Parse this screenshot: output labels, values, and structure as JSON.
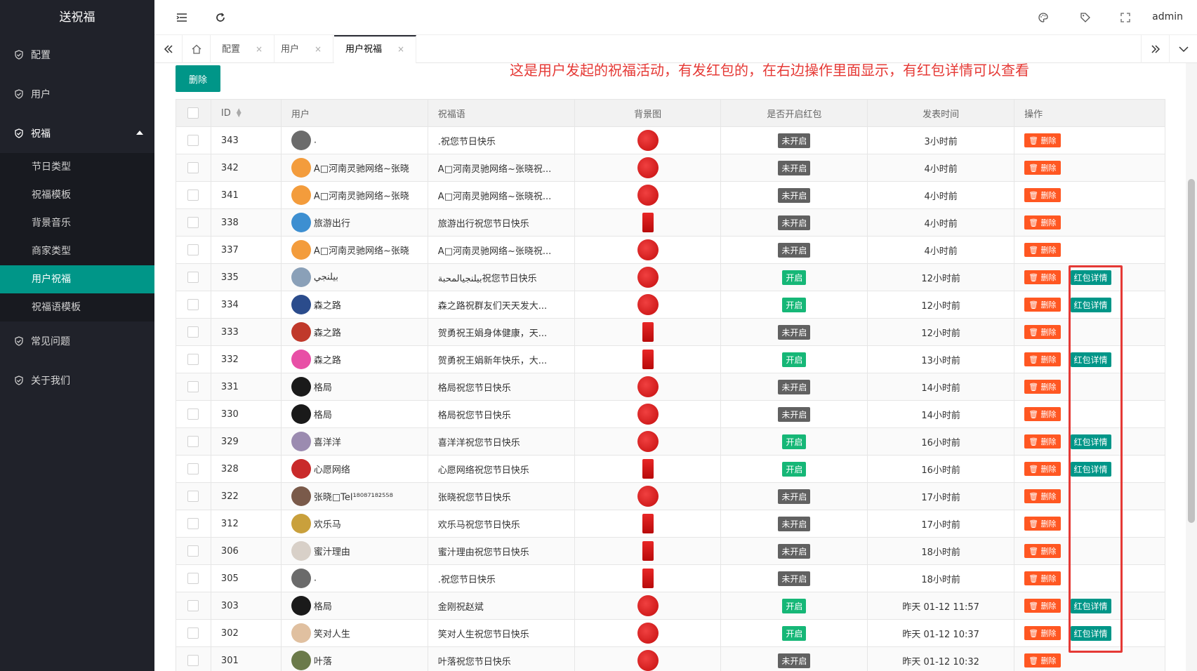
{
  "sidebar": {
    "title": "送祝福",
    "items": [
      {
        "label": "配置"
      },
      {
        "label": "用户"
      },
      {
        "label": "祝福"
      },
      {
        "label": "常见问题"
      },
      {
        "label": "关于我们"
      }
    ],
    "sub_items": [
      {
        "label": "节日类型"
      },
      {
        "label": "祝福模板"
      },
      {
        "label": "背景音乐"
      },
      {
        "label": "商家类型"
      },
      {
        "label": "用户祝福"
      },
      {
        "label": "祝福语模板"
      }
    ]
  },
  "header": {
    "user": "admin"
  },
  "tabs": [
    {
      "label": "配置",
      "close": "×"
    },
    {
      "label": "用户",
      "close": "×"
    },
    {
      "label": "用户祝福",
      "close": "×"
    }
  ],
  "annotation": "这是用户发起的祝福活动，有发红包的，在右边操作里面显示，有红包详情可以查看",
  "toolbar": {
    "delete_label": "删除"
  },
  "table": {
    "headers": [
      "ID",
      "用户",
      "祝福语",
      "背景图",
      "是否开启红包",
      "发表时间",
      "操作"
    ],
    "op_delete": "🗑 删除",
    "op_redpacket": "红包详情",
    "rows": [
      {
        "id": "343",
        "user": ".",
        "msg": ".祝您节日快乐",
        "bg": "circle",
        "red": "未开启",
        "on": false,
        "time": "3小时前",
        "avatar": "#6b6b6b"
      },
      {
        "id": "342",
        "user": "A□河南灵驰网络~张晓",
        "msg": "A□河南灵驰网络~张晓祝...",
        "bg": "circle",
        "red": "未开启",
        "on": false,
        "time": "4小时前",
        "avatar": "#f39c3c"
      },
      {
        "id": "341",
        "user": "A□河南灵驰网络~张晓",
        "msg": "A□河南灵驰网络~张晓祝...",
        "bg": "circle",
        "red": "未开启",
        "on": false,
        "time": "4小时前",
        "avatar": "#f39c3c"
      },
      {
        "id": "338",
        "user": "旅游出行",
        "msg": "旅游出行祝您节日快乐",
        "bg": "rect",
        "red": "未开启",
        "on": false,
        "time": "4小时前",
        "avatar": "#3d8fd1"
      },
      {
        "id": "337",
        "user": "A□河南灵驰网络~张晓",
        "msg": "A□河南灵驰网络~张晓祝...",
        "bg": "circle",
        "red": "未开启",
        "on": false,
        "time": "4小时前",
        "avatar": "#f39c3c"
      },
      {
        "id": "335",
        "user": "بيلنجي",
        "msg": "بيلنجيالمحبة祝您节日快乐",
        "bg": "circle",
        "red": "开启",
        "on": true,
        "time": "12小时前",
        "avatar": "#8aa0b8"
      },
      {
        "id": "334",
        "user": "森之路",
        "msg": "森之路祝群友们天天发大...",
        "bg": "circle",
        "red": "开启",
        "on": true,
        "time": "12小时前",
        "avatar": "#2b4c8c"
      },
      {
        "id": "333",
        "user": "森之路",
        "msg": "贺勇祝王娟身体健康，天...",
        "bg": "rect",
        "red": "未开启",
        "on": false,
        "time": "12小时前",
        "avatar": "#c0392b"
      },
      {
        "id": "332",
        "user": "森之路",
        "msg": "贺勇祝王娟新年快乐，大...",
        "bg": "rect",
        "red": "开启",
        "on": true,
        "time": "13小时前",
        "avatar": "#e84fa6"
      },
      {
        "id": "331",
        "user": "格局",
        "msg": "格局祝您节日快乐",
        "bg": "circle",
        "red": "未开启",
        "on": false,
        "time": "14小时前",
        "avatar": "#1a1a1a"
      },
      {
        "id": "330",
        "user": "格局",
        "msg": "格局祝您节日快乐",
        "bg": "circle",
        "red": "未开启",
        "on": false,
        "time": "14小时前",
        "avatar": "#1a1a1a"
      },
      {
        "id": "329",
        "user": "喜洋洋",
        "msg": "喜洋洋祝您节日快乐",
        "bg": "circle",
        "red": "开启",
        "on": true,
        "time": "16小时前",
        "avatar": "#9b8bb0"
      },
      {
        "id": "328",
        "user": "心愿网络",
        "msg": "心愿网络祝您节日快乐",
        "bg": "rect",
        "red": "开启",
        "on": true,
        "time": "16小时前",
        "avatar": "#c92a2a"
      },
      {
        "id": "322",
        "user": "张晓□Tel¹⁸⁰⁸⁷¹⁸²⁵⁵⁸",
        "msg": "张晓祝您节日快乐",
        "bg": "circle",
        "red": "未开启",
        "on": false,
        "time": "17小时前",
        "avatar": "#7a5a4a"
      },
      {
        "id": "312",
        "user": "欢乐马",
        "msg": "欢乐马祝您节日快乐",
        "bg": "rect",
        "red": "未开启",
        "on": false,
        "time": "17小时前",
        "avatar": "#c9a03c"
      },
      {
        "id": "306",
        "user": "蜜汁理由",
        "msg": "蜜汁理由祝您节日快乐",
        "bg": "rect",
        "red": "未开启",
        "on": false,
        "time": "18小时前",
        "avatar": "#d8d0c8"
      },
      {
        "id": "305",
        "user": ".",
        "msg": ".祝您节日快乐",
        "bg": "rect",
        "red": "未开启",
        "on": false,
        "time": "18小时前",
        "avatar": "#6b6b6b"
      },
      {
        "id": "303",
        "user": "格局",
        "msg": "金刚祝赵斌",
        "bg": "circle",
        "red": "开启",
        "on": true,
        "time": "昨天 01-12 11:57",
        "avatar": "#1a1a1a"
      },
      {
        "id": "302",
        "user": "笑对人生",
        "msg": "笑对人生祝您节日快乐",
        "bg": "circle",
        "red": "开启",
        "on": true,
        "time": "昨天 01-12 10:37",
        "avatar": "#e0c0a0"
      },
      {
        "id": "301",
        "user": "叶落",
        "msg": "叶落祝您节日快乐",
        "bg": "circle",
        "red": "未开启",
        "on": false,
        "time": "昨天 01-12 10:32",
        "avatar": "#6b7a4a"
      }
    ]
  },
  "colors": {
    "sidebar_bg": "#20222a",
    "active": "#009688",
    "danger": "#ff5722",
    "annotation": "#e53935"
  }
}
